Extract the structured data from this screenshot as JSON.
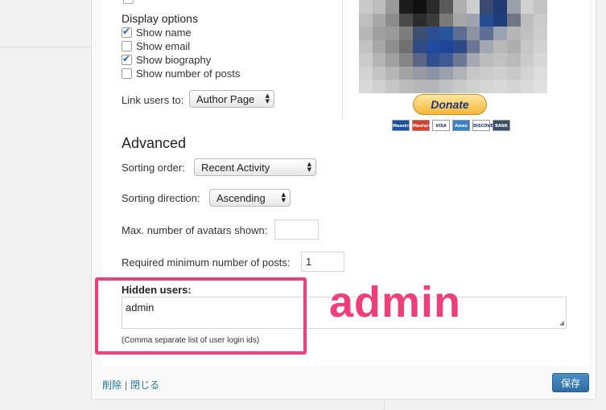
{
  "display_options": {
    "title": "Display options",
    "items": [
      {
        "label": "Show name",
        "checked": true
      },
      {
        "label": "Show email",
        "checked": false
      },
      {
        "label": "Show biography",
        "checked": true
      },
      {
        "label": "Show number of posts",
        "checked": false
      }
    ]
  },
  "link_users": {
    "label": "Link users to:",
    "value": "Author Page"
  },
  "advanced": {
    "title": "Advanced",
    "sorting_order": {
      "label": "Sorting order:",
      "value": "Recent Activity"
    },
    "sorting_direction": {
      "label": "Sorting direction:",
      "value": "Ascending"
    },
    "max_avatars": {
      "label": "Max. number of avatars shown:",
      "value": ""
    },
    "min_posts": {
      "label": "Required minimum number of posts:",
      "value": "1"
    },
    "hidden_users": {
      "label": "Hidden users:",
      "value": "admin",
      "hint": "(Comma separate list of user login ids)"
    }
  },
  "annotation": {
    "text": "admin",
    "color": "#ee3f7a"
  },
  "donate": {
    "label": "Donate",
    "cards": [
      {
        "label": "Maestro",
        "color": "#1b4f9c"
      },
      {
        "label": "MasterCard",
        "color": "#d8402f"
      },
      {
        "label": "VISA",
        "color": "#ffffff"
      },
      {
        "label": "Amex",
        "color": "#3b7fc4"
      },
      {
        "label": "DISCOVER",
        "color": "#ffffff"
      },
      {
        "label": "BANK",
        "color": "#3b5066"
      }
    ]
  },
  "footer": {
    "delete_label": "削除",
    "close_label": "閉じる",
    "save_label": "保存"
  },
  "colors": {
    "accent": "#21759b",
    "save_button": "#2e6ea5",
    "highlight": "#ee3f7a"
  }
}
